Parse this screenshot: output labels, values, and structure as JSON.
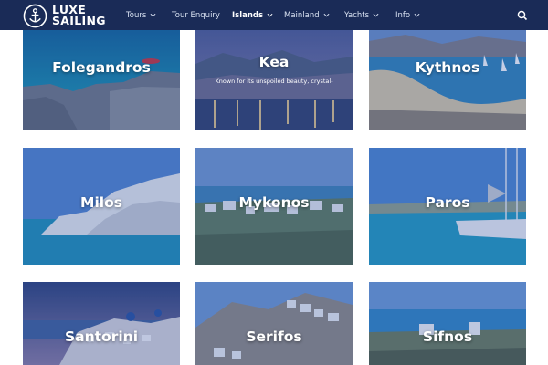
{
  "header": {
    "logo_line1": "LUXE",
    "logo_line2": "SAILING",
    "nav": [
      {
        "label": "Tours",
        "has_dropdown": true,
        "active": false
      },
      {
        "label": "Tour Enquiry",
        "has_dropdown": false,
        "active": false
      },
      {
        "label": "Islands",
        "has_dropdown": true,
        "active": true
      },
      {
        "label": "Mainland",
        "has_dropdown": true,
        "active": false
      },
      {
        "label": "Yachts",
        "has_dropdown": true,
        "active": false
      },
      {
        "label": "Info",
        "has_dropdown": true,
        "active": false
      }
    ],
    "search_icon": "search-icon"
  },
  "islands": [
    {
      "name": "Folegandros",
      "description": ""
    },
    {
      "name": "Kea",
      "description": "Known for its unspoiled beauty, crystal-"
    },
    {
      "name": "Kythnos",
      "description": ""
    },
    {
      "name": "Milos",
      "description": ""
    },
    {
      "name": "Mykonos",
      "description": ""
    },
    {
      "name": "Paros",
      "description": ""
    },
    {
      "name": "Santorini",
      "description": ""
    },
    {
      "name": "Serifos",
      "description": ""
    },
    {
      "name": "Sifnos",
      "description": ""
    }
  ],
  "colors": {
    "navbar": "#1a2b57",
    "overlay": "#2d50a0",
    "text": "#ffffff"
  }
}
